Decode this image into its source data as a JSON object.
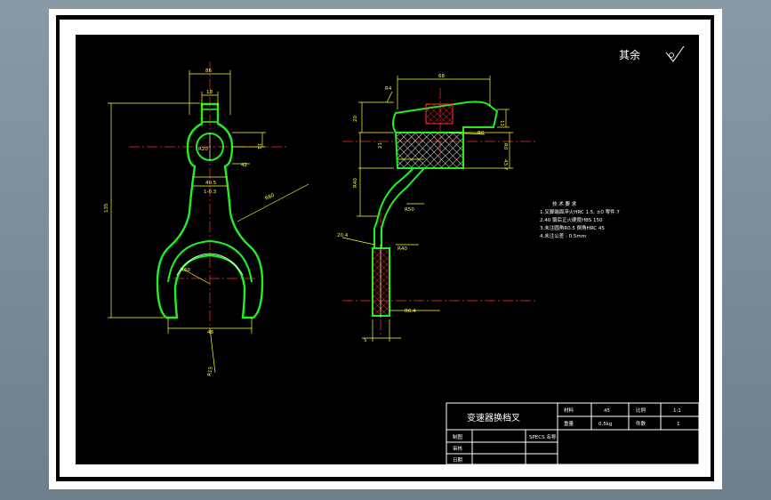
{
  "roughness_note": "其余",
  "part_name": "变速器换档叉",
  "title_block": {
    "material_label": "材料",
    "material_value": "45",
    "scale_label": "比例",
    "scale_value": "1:1",
    "weight_label": "重量",
    "weight_value": "0.5kg",
    "quantity_label": "件数",
    "quantity_value": "1",
    "drawn_label": "制图",
    "checked_label": "审核",
    "date_label": "日期",
    "school_label": "SPECS 名称"
  },
  "tech_requirements": {
    "title": "技 术 要 求",
    "items": [
      "1.叉脚端面淬火HRC 1.5, ±0 零件 7",
      "2.40 锻后正火硬度HBS 150",
      "3.未注圆角R0.5 倒角HRC 45",
      "4.未注公差 : 0.5mm"
    ]
  },
  "front_view_dims": [
    "86",
    "18",
    "R20",
    "11",
    "42",
    "40.5",
    "1-0.3",
    "R60",
    "135",
    "R60",
    "48",
    "R15"
  ],
  "side_view_dims": [
    "68",
    "R4",
    "20",
    "11",
    "R6",
    "21",
    "R0",
    "43.7",
    "R40",
    "R50",
    "20.4",
    "R40",
    "R6.4",
    "5"
  ]
}
